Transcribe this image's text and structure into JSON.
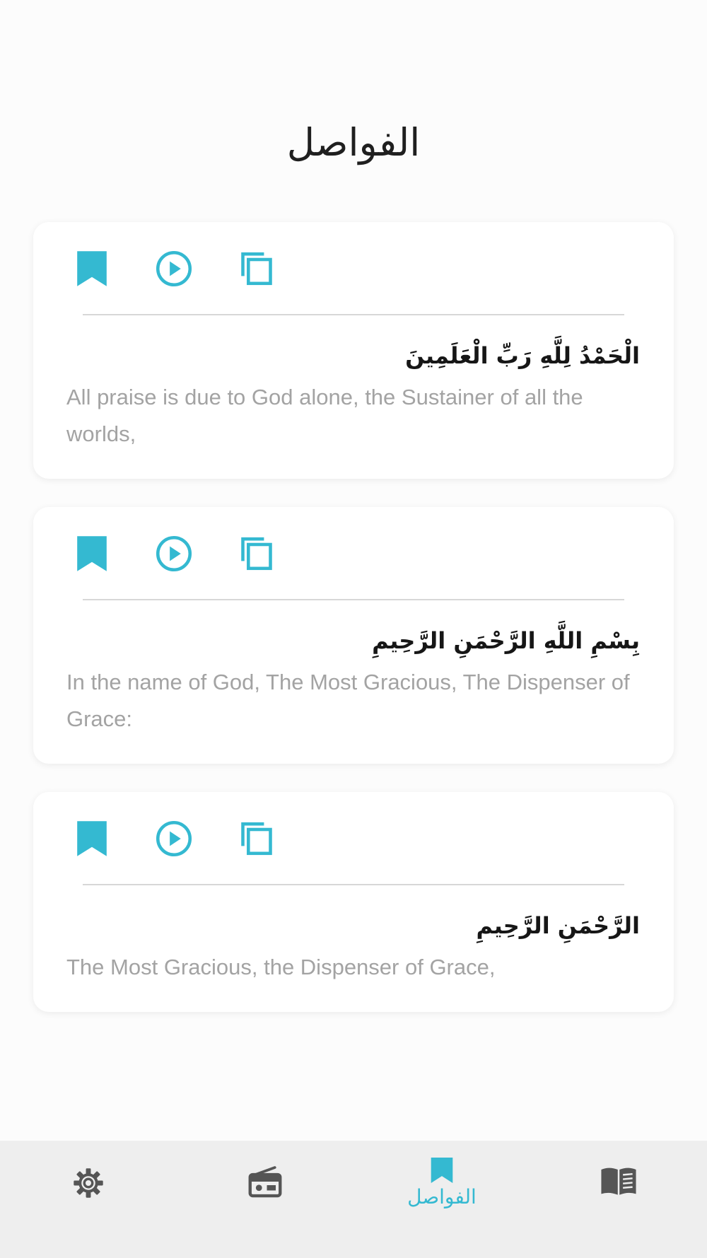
{
  "page": {
    "title": "الفواصل"
  },
  "colors": {
    "accent": "#34B9D1",
    "background": "#FCFCFC",
    "card": "#FFFFFF",
    "arabic_text": "#161616",
    "translation_text": "#A3A3A3",
    "nav_background": "#EEEEEE",
    "nav_icon": "#555555"
  },
  "bookmarks": [
    {
      "arabic": "الْحَمْدُ لِلَّهِ رَبِّ الْعَلَمِينَ",
      "translation": "All praise is due to God alone, the Sustainer of all the worlds,"
    },
    {
      "arabic": "بِسْمِ اللَّهِ الرَّحْمَنِ الرَّحِيمِ",
      "translation": "In the name of God, The Most Gracious, The Dispenser of Grace:"
    },
    {
      "arabic": "الرَّحْمَنِ الرَّحِيمِ",
      "translation": "The Most Gracious, the Dispenser of Grace,"
    }
  ],
  "card_actions": {
    "bookmark_icon": "bookmark-icon",
    "play_icon": "play-circle-icon",
    "copy_icon": "copy-icon"
  },
  "bottom_nav": {
    "items": [
      {
        "icon": "gear-icon",
        "label": "",
        "active": false
      },
      {
        "icon": "radio-icon",
        "label": "",
        "active": false
      },
      {
        "icon": "bookmark-icon",
        "label": "الفواصل",
        "active": true
      },
      {
        "icon": "book-icon",
        "label": "",
        "active": false
      }
    ]
  }
}
